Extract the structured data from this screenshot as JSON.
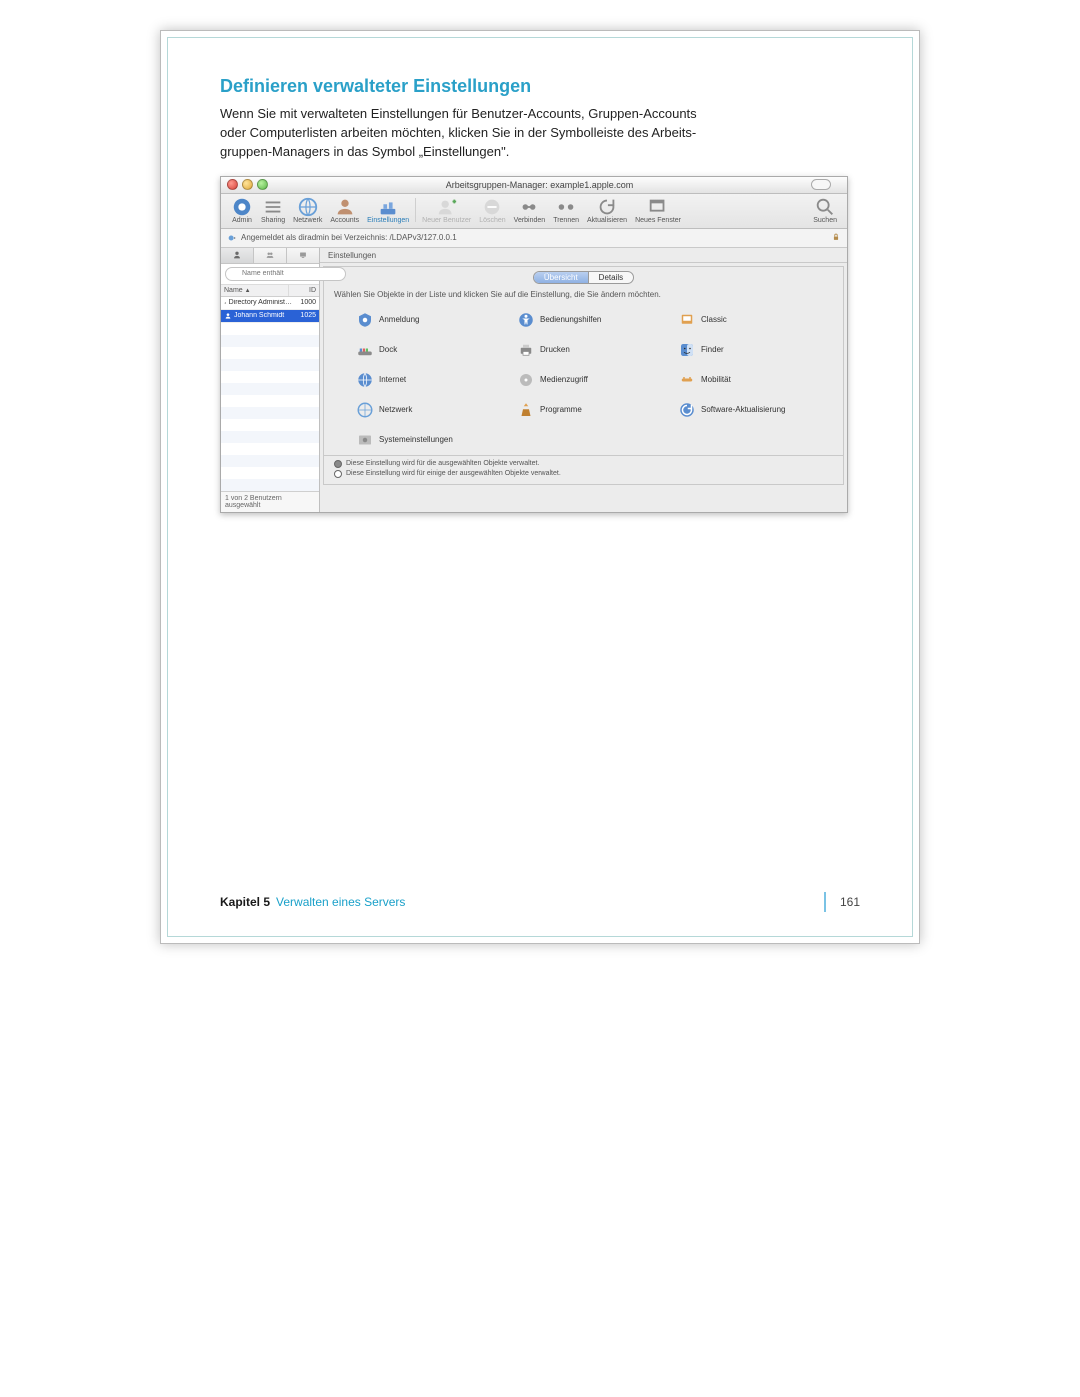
{
  "page": {
    "section_title": "Definieren verwalteter Einstellungen",
    "body_line1": "Wenn Sie mit verwalteten Einstellungen für Benutzer-Accounts, Gruppen-Accounts",
    "body_line2": "oder Computerlisten arbeiten möchten, klicken Sie in der Symbolleiste des Arbeits-",
    "body_line3": "gruppen-Managers in das Symbol „Einstellungen\"."
  },
  "footer": {
    "chapter_label": "Kapitel 5",
    "chapter_title": "Verwalten eines Servers",
    "page_number": "161"
  },
  "window": {
    "title": "Arbeitsgruppen-Manager: example1.apple.com",
    "toolbar": {
      "admin": "Admin",
      "sharing": "Sharing",
      "netzwerk": "Netzwerk",
      "accounts": "Accounts",
      "einstellungen": "Einstellungen",
      "neuer_benutzer": "Neuer Benutzer",
      "loeschen": "Löschen",
      "verbinden": "Verbinden",
      "trennen": "Trennen",
      "aktualisieren": "Aktualisieren",
      "neues_fenster": "Neues Fenster",
      "suchen": "Suchen"
    },
    "auth_bar": "Angemeldet als diradmin bei Verzeichnis: /LDAPv3/127.0.0.1"
  },
  "sidebar": {
    "search_placeholder": "Name enthält",
    "columns": {
      "name": "Name",
      "id": "ID"
    },
    "rows": [
      {
        "name": "Directory Administ…",
        "id": "1000"
      },
      {
        "name": "Johann Schmidt",
        "id": "1025"
      }
    ],
    "status": "1 von 2 Benutzern ausgewählt"
  },
  "main": {
    "header": "Einstellungen",
    "tabs": {
      "overview": "Übersicht",
      "details": "Details"
    },
    "instruction": "Wählen Sie Objekte in der Liste und klicken Sie auf die Einstellung, die Sie ändern möchten.",
    "prefs": {
      "anmeldung": "Anmeldung",
      "bedienungshilfen": "Bedienungshilfen",
      "classic": "Classic",
      "dock": "Dock",
      "drucken": "Drucken",
      "finder": "Finder",
      "internet": "Internet",
      "medienzugriff": "Medienzugriff",
      "mobilitaet": "Mobilität",
      "netzwerk": "Netzwerk",
      "programme": "Programme",
      "software_akt": "Software-Aktualisierung",
      "system": "Systemeinstellungen"
    },
    "footer": {
      "line1": "Diese Einstellung wird für die ausgewählten Objekte verwaltet.",
      "line2": "Diese Einstellung wird für einige der ausgewählten Objekte verwaltet."
    }
  }
}
